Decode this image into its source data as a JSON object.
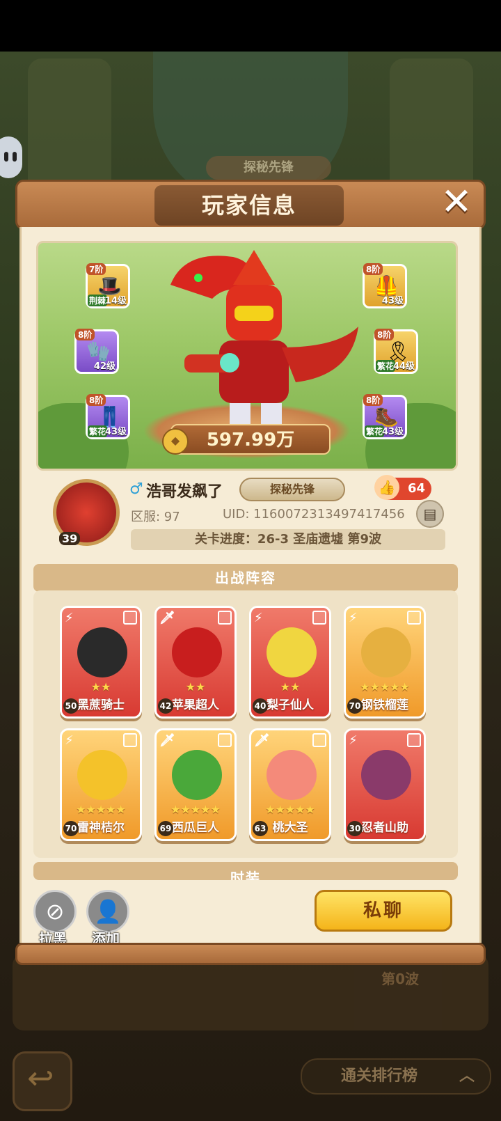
{
  "background": {
    "badge": "探秘先锋",
    "wave": "第0波",
    "rank_button": "通关排行榜"
  },
  "dialog": {
    "title": "玩家信息",
    "close_symbol": "✕"
  },
  "scene": {
    "power": "597.99万",
    "equipment": [
      {
        "tier": "7阶",
        "level": "14级",
        "suffix": "荆棘",
        "rarity": "gold",
        "icon": "hat-icon"
      },
      {
        "tier": "8阶",
        "level": "42级",
        "suffix": "",
        "rarity": "purple",
        "icon": "gloves-icon"
      },
      {
        "tier": "8阶",
        "level": "43级",
        "suffix": "繁花",
        "rarity": "purple",
        "icon": "pants-icon"
      },
      {
        "tier": "8阶",
        "level": "43级",
        "suffix": "",
        "rarity": "gold",
        "icon": "armor-icon"
      },
      {
        "tier": "8阶",
        "level": "44级",
        "suffix": "繁花",
        "rarity": "gold",
        "icon": "belt-icon"
      },
      {
        "tier": "8阶",
        "level": "43级",
        "suffix": "繁花",
        "rarity": "purple",
        "icon": "boots-icon"
      }
    ]
  },
  "player": {
    "avatar_level": "39",
    "name": "浩哥发飙了",
    "badge": "探秘先锋",
    "likes": "64",
    "server": "区服: 97",
    "uid": "UID: 1160072313497417456",
    "stage": "关卡进度：26-3  圣庙遗墟 第9波"
  },
  "lineup": {
    "title": "出战阵容",
    "cards": [
      {
        "name": "黑蔗骑士",
        "level": "50",
        "stars": "★★",
        "color": "red"
      },
      {
        "name": "苹果超人",
        "level": "42",
        "stars": "★★",
        "color": "red"
      },
      {
        "name": "梨子仙人",
        "level": "40",
        "stars": "★★",
        "color": "red"
      },
      {
        "name": "钢铁榴莲",
        "level": "70",
        "stars": "★★★★★",
        "color": "gold"
      },
      {
        "name": "雷神桔尔",
        "level": "70",
        "stars": "★★★★★",
        "color": "gold"
      },
      {
        "name": "西瓜巨人",
        "level": "69",
        "stars": "★★★★★",
        "color": "gold"
      },
      {
        "name": "桃大圣",
        "level": "63",
        "stars": "★★★★★",
        "color": "gold"
      },
      {
        "name": "忍者山助",
        "level": "30",
        "stars": "",
        "color": "red"
      }
    ]
  },
  "fashion": {
    "title": "时装"
  },
  "actions": {
    "block_label": "拉黑",
    "add_label": "添加",
    "chat_label": "私聊"
  }
}
